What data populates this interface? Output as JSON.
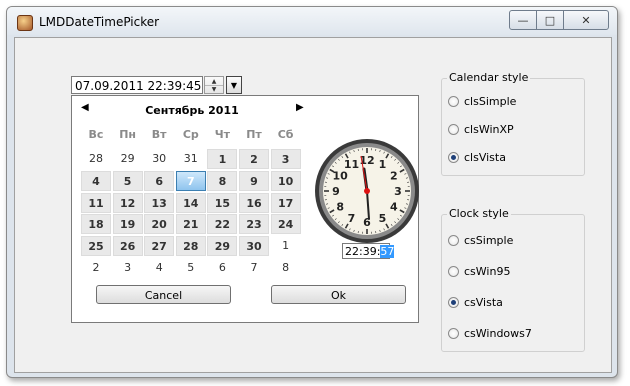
{
  "window": {
    "title": "LMDDateTimePicker",
    "minimize_glyph": "—",
    "maximize_glyph": "□",
    "close_glyph": "✕"
  },
  "picker": {
    "value": "07.09.2011 22:39:45",
    "spin_up": "▲",
    "spin_down": "▼",
    "drop_glyph": "▼"
  },
  "calendar": {
    "prev": "◀",
    "next": "▶",
    "month_title": "Сентябрь 2011",
    "weekdays": [
      "Вс",
      "Пн",
      "Вт",
      "Ср",
      "Чт",
      "Пт",
      "Сб"
    ],
    "weeks": [
      [
        "28",
        "29",
        "30",
        "31",
        "1",
        "2",
        "3"
      ],
      [
        "4",
        "5",
        "6",
        "7",
        "8",
        "9",
        "10"
      ],
      [
        "11",
        "12",
        "13",
        "14",
        "15",
        "16",
        "17"
      ],
      [
        "18",
        "19",
        "20",
        "21",
        "22",
        "23",
        "24"
      ],
      [
        "25",
        "26",
        "27",
        "28",
        "29",
        "30",
        "1"
      ],
      [
        "2",
        "3",
        "4",
        "5",
        "6",
        "7",
        "8"
      ]
    ],
    "selected_day": "7",
    "clock_numbers": [
      "12",
      "1",
      "2",
      "3",
      "4",
      "5",
      "6",
      "7",
      "8",
      "9",
      "10",
      "11"
    ],
    "time_prefix": "22:39:",
    "time_seconds": "57",
    "cancel_label": "Cancel",
    "ok_label": "Ok"
  },
  "calendar_style": {
    "title": "Calendar style",
    "options": [
      "clsSimple",
      "clsWinXP",
      "clsVista"
    ],
    "selected": "clsVista"
  },
  "clock_style": {
    "title": "Clock style",
    "options": [
      "csSimple",
      "csWin95",
      "csVista",
      "csWindows7"
    ],
    "selected": "csVista"
  }
}
